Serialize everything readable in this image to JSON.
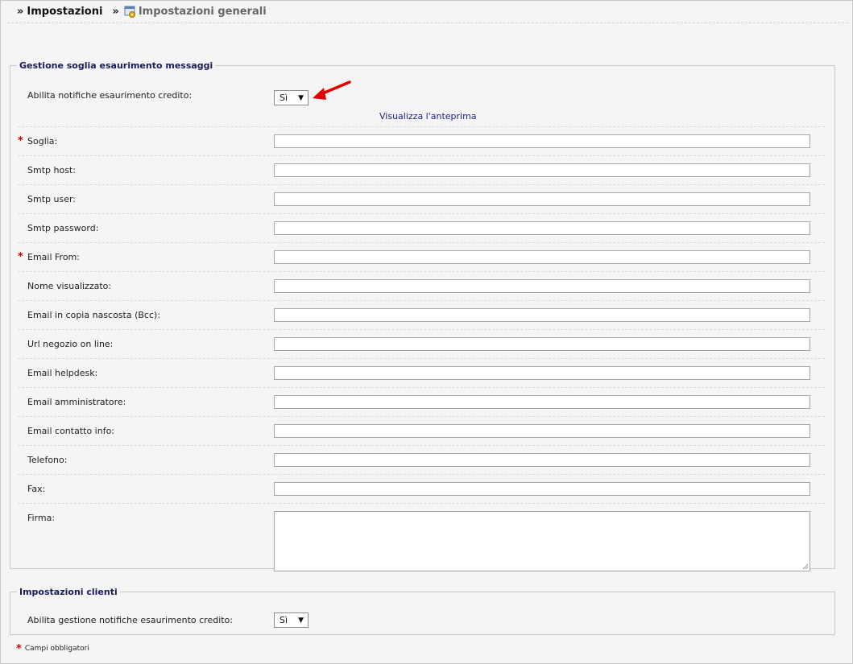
{
  "breadcrumb": {
    "sep": "»",
    "item1": "Impostazioni",
    "item2": "Impostazioni generali",
    "icon": "settings-icon"
  },
  "section1": {
    "legend": "Gestione soglia esaurimento messaggi",
    "enable_label": "Abilita notifiche esaurimento credito:",
    "enable_value": "Sì",
    "preview_link": "Visualizza l'anteprima",
    "fields": {
      "soglia": "Soglia:",
      "smtp_host": "Smtp host:",
      "smtp_user": "Smtp user:",
      "smtp_password": "Smtp password:",
      "email_from": "Email From:",
      "nome_visualizzato": "Nome visualizzato:",
      "email_bcc": "Email in copia nascosta (Bcc):",
      "url_negozio": "Url negozio on line:",
      "email_helpdesk": "Email helpdesk:",
      "email_amministratore": "Email amministratore:",
      "email_contatto": "Email contatto info:",
      "telefono": "Telefono:",
      "fax": "Fax:",
      "firma": "Firma:"
    },
    "required_mark": "*"
  },
  "section2": {
    "legend": "Impostazioni clienti",
    "enable_label": "Abilita gestione notifiche esaurimento credito:",
    "enable_value": "Sì"
  },
  "footnote": {
    "star": "*",
    "text": "Campi obbligatori"
  },
  "colors": {
    "required": "#d40000",
    "legend": "#1a1a5c",
    "link": "#1a1a8c",
    "arrow": "#e00000"
  }
}
